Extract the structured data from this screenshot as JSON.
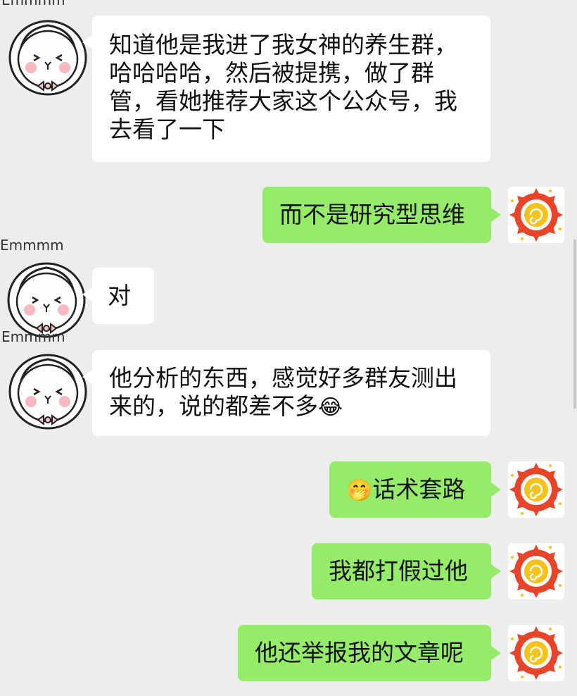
{
  "contact": {
    "nickname_handwriting": "Emmmm"
  },
  "messages": [
    {
      "side": "in",
      "text": "知道他是我进了我女神的养生群，哈哈哈哈，然后被提携，做了群管，看她推荐大家这个公众号，我去看了一下"
    },
    {
      "side": "out",
      "text": "而不是研究型思维"
    },
    {
      "side": "in",
      "text": "对"
    },
    {
      "side": "in",
      "text": "他分析的东西，感觉好多群友测出来的，说的都差不多",
      "trailing_emoji": "😂"
    },
    {
      "side": "out",
      "text": "话术套路",
      "leading_emoji": "🤭"
    },
    {
      "side": "out",
      "text": "我都打假过他"
    },
    {
      "side": "out",
      "text": "他还举报我的文章呢"
    }
  ],
  "colors": {
    "background": "#ededed",
    "incoming_bubble": "#ffffff",
    "outgoing_bubble": "#95ec69",
    "avatar_sun_outer": "#e8442a",
    "avatar_sun_inner": "#f7c21b"
  },
  "icons": {
    "contact_avatar": "cartoon-face-hood-avatar",
    "my_avatar": "sun-pattern-avatar"
  }
}
